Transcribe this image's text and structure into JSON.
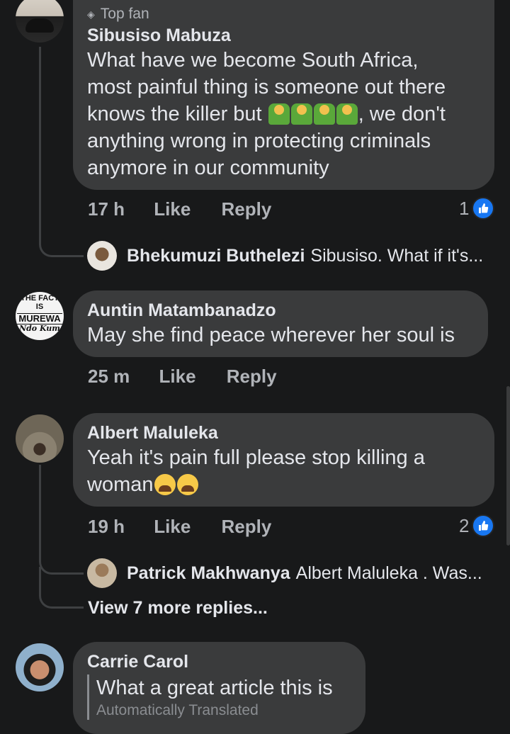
{
  "comments": [
    {
      "badge": "Top fan",
      "badge_icon": "diamond-icon",
      "author": "Sibusiso Mabuza",
      "text_lines": [
        "What have we become South Africa,",
        "most painful thing is someone out there",
        "knows the killer but",
        ", we don't",
        "anything wrong in protecting criminals",
        "anymore in our community"
      ],
      "emojis": [
        "man-shrugging-emoji",
        "man-shrugging-emoji",
        "man-shrugging-emoji",
        "man-shrugging-emoji"
      ],
      "time": "17 h",
      "like_label": "Like",
      "reply_label": "Reply",
      "reaction_count": "1",
      "reply": {
        "author": "Bhekumuzi Buthelezi",
        "preview": "Sibusiso. What if it's..."
      }
    },
    {
      "avatar_text": [
        "THE FACT",
        "IS",
        "MUREWA",
        "Ndo Kum"
      ],
      "author": "Auntin Matambanadzo",
      "text_lines": [
        "May she find peace wherever her soul is"
      ],
      "time": "25 m",
      "like_label": "Like",
      "reply_label": "Reply"
    },
    {
      "author": "Albert Maluleka",
      "text_lines": [
        "Yeah it's pain full please stop killing a",
        "woman"
      ],
      "emojis": [
        "crying-face-emoji",
        "crying-face-emoji"
      ],
      "time": "19 h",
      "like_label": "Like",
      "reply_label": "Reply",
      "reaction_count": "2",
      "reply": {
        "author": "Patrick Makhwanya",
        "preview": "Albert Maluleka . Was..."
      },
      "more_replies": "View 7 more replies..."
    },
    {
      "author": "Carrie Carol",
      "text_lines": [
        "What a great article this is"
      ],
      "translated_label": "Automatically Translated"
    }
  ],
  "colors": {
    "background": "#18191a",
    "bubble": "#3a3b3c",
    "text": "#e4e6eb",
    "secondary": "#b0b3b8",
    "like_blue": "#1877f2"
  }
}
